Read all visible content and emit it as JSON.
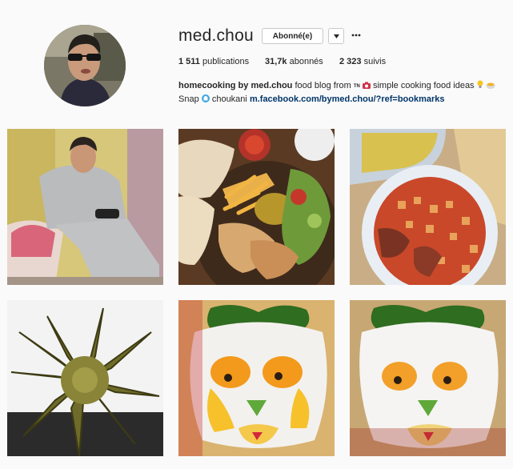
{
  "profile": {
    "username": "med.chou",
    "follow_button": "Abonné(e)",
    "dropdown_icon": "chevron-down-icon",
    "more_icon": "more-options-icon"
  },
  "stats": {
    "posts_value": "1 511",
    "posts_label": "publications",
    "followers_value": "31,7k",
    "followers_label": "abonnés",
    "following_value": "2 323",
    "following_label": "suivis"
  },
  "bio": {
    "name": "homecooking by med.chou",
    "text_1": "food blog from",
    "flag": "TN",
    "text_2": "simple cooking food ideas",
    "snap_label": "Snap",
    "snap_handle": "choukani",
    "link": "m.facebook.com/bymed.chou/?ref=bookmarks"
  },
  "posts": [
    {
      "subject": "man-sitting-on-couch-with-controller"
    },
    {
      "subject": "plate-with-fries-bread-salad-chicken"
    },
    {
      "subject": "potato-meat-stew-plate"
    },
    {
      "subject": "cooked-artichoke"
    },
    {
      "subject": "fried-egg-face-with-parsley-hair"
    },
    {
      "subject": "fried-egg-face-variant"
    }
  ],
  "colors": {
    "link": "#003569",
    "text": "#262626",
    "background": "#fafafa",
    "border": "#c9c9c9"
  }
}
